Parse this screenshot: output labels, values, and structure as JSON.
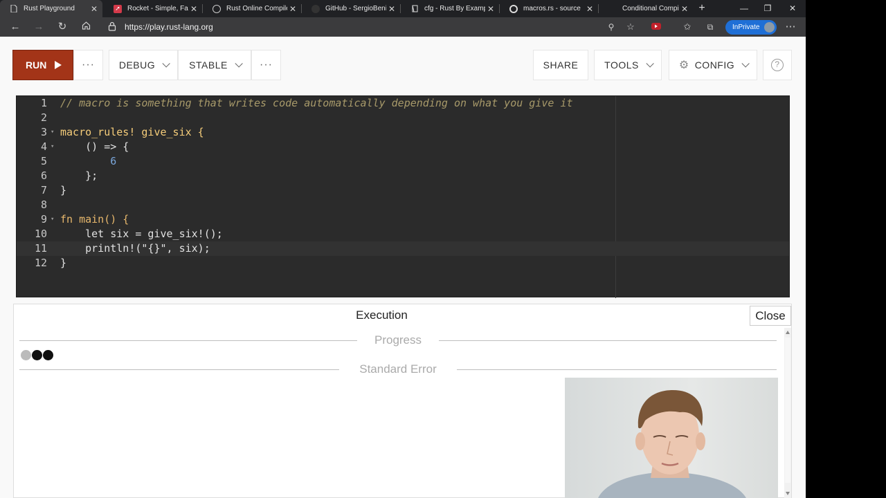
{
  "browser": {
    "tabs": [
      {
        "title": "Rust Playground",
        "icon": "playground-page-icon",
        "active": true
      },
      {
        "title": "Rocket - Simple, Fast,",
        "icon": "rocket-icon",
        "active": false
      },
      {
        "title": "Rust Online Compiler",
        "icon": "compiler-icon",
        "active": false
      },
      {
        "title": "GitHub - SergioBenite",
        "icon": "github-icon",
        "active": false
      },
      {
        "title": "cfg - Rust By Example",
        "icon": "rust-book-icon",
        "active": false
      },
      {
        "title": "macros.rs - source",
        "icon": "rust-docs-icon",
        "active": false
      },
      {
        "title": "Conditional Compilati",
        "icon": "page-icon",
        "active": false
      }
    ],
    "url": "https://play.rust-lang.org",
    "inprivate_label": "InPrivate"
  },
  "toolbar": {
    "run_label": "RUN",
    "debug_label": "DEBUG",
    "stable_label": "STABLE",
    "share_label": "SHARE",
    "tools_label": "TOOLS",
    "config_label": "CONFIG",
    "more_label": "···",
    "help_label": "?"
  },
  "editor": {
    "lines": [
      {
        "n": "1",
        "code": "// macro is something that writes code automatically depending on what you give it"
      },
      {
        "n": "2",
        "code": ""
      },
      {
        "n": "3",
        "code": "macro_rules! give_six {"
      },
      {
        "n": "4",
        "code": "    () => {"
      },
      {
        "n": "5",
        "code": "        6"
      },
      {
        "n": "6",
        "code": "    };"
      },
      {
        "n": "7",
        "code": "}"
      },
      {
        "n": "8",
        "code": ""
      },
      {
        "n": "9",
        "code": "fn main() {"
      },
      {
        "n": "10",
        "code": "    let six = give_six!();"
      },
      {
        "n": "11",
        "code": "    println!(\"{}\", six);"
      },
      {
        "n": "12",
        "code": "}"
      }
    ]
  },
  "output": {
    "title": "Execution",
    "close_label": "Close",
    "progress_label": "Progress",
    "stderr_label": "Standard Error"
  },
  "colors": {
    "run_button": "#a33418",
    "editor_bg": "#2b2b2b",
    "inprivate_badge": "#1f6fd6"
  }
}
